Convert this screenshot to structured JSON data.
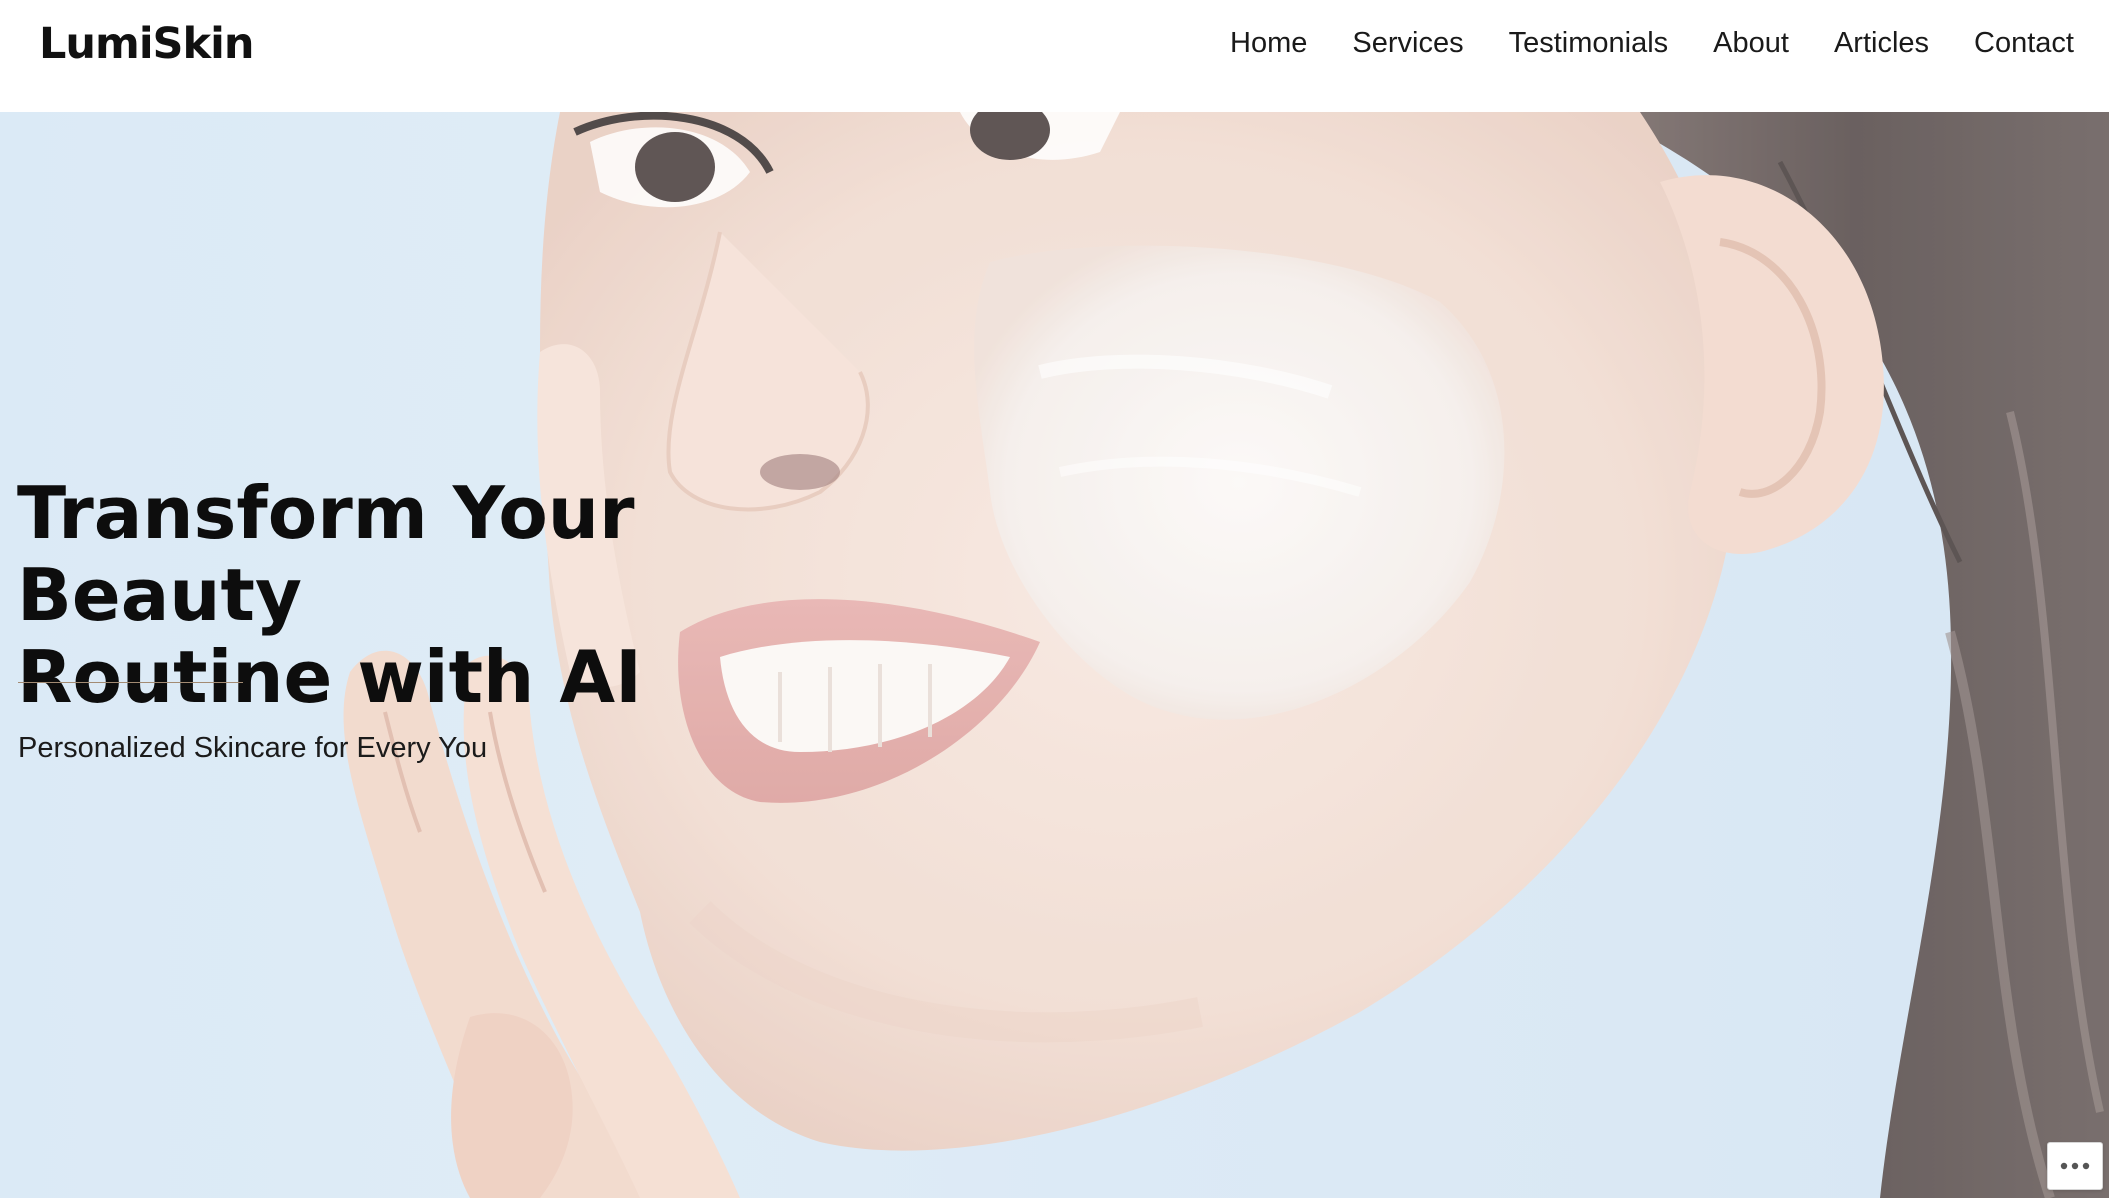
{
  "header": {
    "logo_text": "LumiSkin",
    "nav": [
      {
        "label": "Home"
      },
      {
        "label": "Services"
      },
      {
        "label": "Testimonials"
      },
      {
        "label": "About"
      },
      {
        "label": "Articles"
      },
      {
        "label": "Contact"
      }
    ]
  },
  "hero": {
    "title_line1": "Transform Your Beauty",
    "title_line2": "Routine with AI",
    "subtitle": "Personalized Skincare for Every You",
    "background_image": "smiling-woman-applying-face-cream-photo",
    "divider_color": "#a38b73"
  },
  "widgets": {
    "more_button_icon": "ellipsis-icon"
  }
}
